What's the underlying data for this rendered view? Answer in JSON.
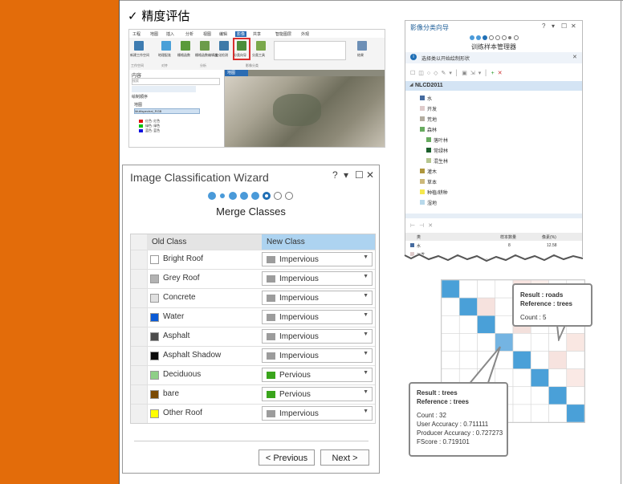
{
  "page": {
    "heading": "✓  精度评估"
  },
  "ribbon": {
    "tabs": [
      "工程",
      "地图",
      "插入",
      "分析",
      "视图",
      "编辑",
      "影像",
      "共享",
      "智能图层",
      "外观"
    ],
    "buttons": [
      "新建工作空间",
      "地理配准",
      "栅格函数",
      "栅格函数编辑器",
      "变化检测",
      "分类向导",
      "分类工具",
      "结果"
    ],
    "groups": [
      "工作空间",
      "对齐",
      "分析",
      "影像分类"
    ],
    "contents_title": "内容",
    "contents_search": "搜索",
    "contents_drawing_order": "绘制顺序",
    "contents_items": [
      "地图",
      "Multispectral_RGB",
      "红色: 红色",
      "绿色: 绿色",
      "蓝色: 蓝色"
    ],
    "map_tab": "地图"
  },
  "wizard": {
    "title": "Image Classification Wizard",
    "controls": [
      "?",
      "▾",
      "☐",
      "✕"
    ],
    "step_title": "Merge Classes",
    "columns": {
      "old": "Old Class",
      "new": "New Class"
    },
    "rows": [
      {
        "old": "Bright Roof",
        "old_color": "#ffffff",
        "new": "Impervious",
        "new_color": "#9c9c9c"
      },
      {
        "old": "Grey Roof",
        "old_color": "#b3b3b3",
        "new": "Impervious",
        "new_color": "#9c9c9c"
      },
      {
        "old": "Concrete",
        "old_color": "#e0e0e0",
        "new": "Impervious",
        "new_color": "#9c9c9c"
      },
      {
        "old": "Water",
        "old_color": "#0a5ad6",
        "new": "Impervious",
        "new_color": "#9c9c9c"
      },
      {
        "old": "Asphalt",
        "old_color": "#4b4b4b",
        "new": "Impervious",
        "new_color": "#9c9c9c"
      },
      {
        "old": "Asphalt Shadow",
        "old_color": "#0a0a0a",
        "new": "Impervious",
        "new_color": "#9c9c9c"
      },
      {
        "old": "Deciduous",
        "old_color": "#8ecf87",
        "new": "Pervious",
        "new_color": "#3aa51c"
      },
      {
        "old": "bare",
        "old_color": "#7a4a05",
        "new": "Pervious",
        "new_color": "#3aa51c"
      },
      {
        "old": "Other Roof",
        "old_color": "#ffff00",
        "new": "Impervious",
        "new_color": "#9c9c9c"
      }
    ],
    "buttons": {
      "prev": "< Previous",
      "next": "Next >"
    }
  },
  "sample_manager": {
    "title": "影像分类向导",
    "controls": [
      "?",
      "▾",
      "☐",
      "✕"
    ],
    "subtitle": "训练样本管理器",
    "info": "选择类以开始绘制形状",
    "schema": "NLCD2011",
    "tree": [
      {
        "label": "水",
        "color": "#466b9f",
        "level": 1
      },
      {
        "label": "开发",
        "color": "#decaca",
        "level": 1
      },
      {
        "label": "荒地",
        "color": "#b3ac9f",
        "level": 1
      },
      {
        "label": "森林",
        "color": "#68ab5f",
        "level": 1
      },
      {
        "label": "落叶林",
        "color": "#68ab5f",
        "level": 2
      },
      {
        "label": "常绿林",
        "color": "#1c5f2c",
        "level": 2
      },
      {
        "label": "混生林",
        "color": "#b5c58f",
        "level": 2
      },
      {
        "label": "灌木",
        "color": "#af963c",
        "level": 1
      },
      {
        "label": "草本",
        "color": "#ccb879",
        "level": 1
      },
      {
        "label": "种植/耕种",
        "color": "#f5e84e",
        "level": 1
      },
      {
        "label": "湿地",
        "color": "#b8d9eb",
        "level": 1
      }
    ],
    "table_headers": [
      "类",
      "样本数量",
      "像素(%)"
    ],
    "table_rows": [
      {
        "class": "水",
        "count": "8",
        "pct": "12.58"
      },
      {
        "class": "开发",
        "count": "",
        "pct": ""
      }
    ]
  },
  "confusion": {
    "callout_top": {
      "result": "Result : roads",
      "reference": "Reference : trees",
      "count": "Count : 5"
    },
    "callout_bottom": {
      "result": "Result : trees",
      "reference": "Reference : trees",
      "count": "Count : 32",
      "user_acc": "User Accuracy : 0.711111",
      "prod_acc": "Producer Accuracy : 0.727273",
      "fscore": "FScore : 0.719101"
    }
  }
}
